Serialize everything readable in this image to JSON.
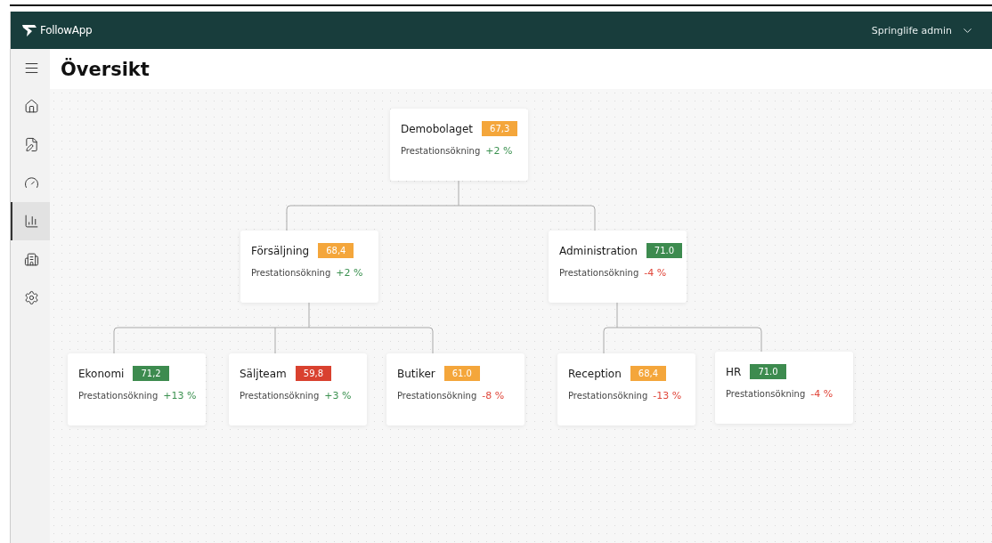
{
  "header": {
    "logo": "FollowApp",
    "user": "Springlife admin"
  },
  "sidebar": {
    "items": [
      {
        "kind": "menu",
        "selected": false
      },
      {
        "kind": "nav",
        "selected": false
      },
      {
        "kind": "nav",
        "selected": false
      },
      {
        "kind": "nav",
        "selected": false
      },
      {
        "kind": "nav",
        "selected": true
      },
      {
        "kind": "nav",
        "selected": false
      },
      {
        "kind": "nav",
        "selected": false
      }
    ]
  },
  "page": {
    "title": "Översikt"
  },
  "tree": {
    "name": "Demobolaget",
    "score": {
      "text": "67,3",
      "color": "#f4a63b"
    },
    "metric": "Prestationsökning",
    "change": {
      "text": "+2 %",
      "color": "#3b9150"
    },
    "children": [
      {
        "name": "Försäljning",
        "score": {
          "text": "68,4",
          "color": "#f4a63b"
        },
        "metric": "Prestationsökning",
        "change": {
          "text": "+2 %",
          "color": "#3b9150"
        },
        "children": [
          {
            "name": "Ekonomi",
            "score": {
              "text": "71,2",
              "color": "#3d8b4f"
            },
            "metric": "Prestationsökning",
            "change": {
              "text": "+13 %",
              "color": "#3b9150"
            }
          },
          {
            "name": "Säljteam",
            "score": {
              "text": "59,8",
              "color": "#d9412f"
            },
            "metric": "Prestationsökning",
            "change": {
              "text": "+3 %",
              "color": "#3b9150"
            }
          },
          {
            "name": "Butiker",
            "score": {
              "text": "61.0",
              "color": "#f4a63b"
            },
            "metric": "Prestationsökning",
            "change": {
              "text": "-8 %",
              "color": "#e0463a"
            }
          }
        ]
      },
      {
        "name": "Administration",
        "score": {
          "text": "71.0",
          "color": "#3d8b4f"
        },
        "metric": "Prestationsökning",
        "change": {
          "text": "-4 %",
          "color": "#e0463a"
        },
        "children": [
          {
            "name": "Reception",
            "score": {
              "text": "68,4",
              "color": "#f4a63b"
            },
            "metric": "Prestationsökning",
            "change": {
              "text": "-13 %",
              "color": "#e0463a"
            }
          },
          {
            "name": "HR",
            "score": {
              "text": "71.0",
              "color": "#3d8b4f"
            },
            "metric": "Prestationsökning",
            "change": {
              "text": "-4 %",
              "color": "#e0463a"
            }
          }
        ]
      }
    ]
  }
}
